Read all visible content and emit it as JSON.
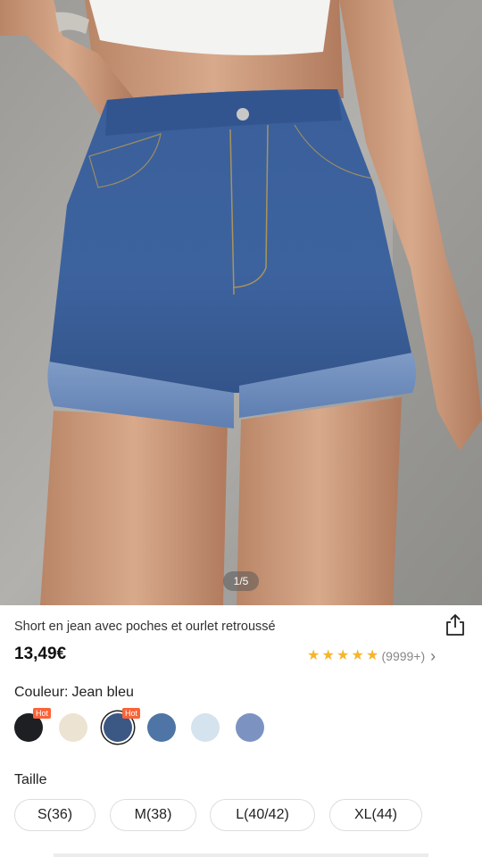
{
  "gallery": {
    "counter": "1/5"
  },
  "product": {
    "title": "Short en jean avec poches et ourlet retroussé",
    "price": "13,49€",
    "rating": {
      "stars": 5,
      "review_count": "(9999+)"
    }
  },
  "color": {
    "label": "Couleur:",
    "selected": "Jean bleu",
    "swatches": [
      {
        "color": "#1d1f22",
        "hot": "Hot",
        "selected": false
      },
      {
        "color": "#ece3d2",
        "hot": null,
        "selected": false
      },
      {
        "color": "#3b5783",
        "hot": "Hot",
        "selected": true
      },
      {
        "color": "#4f74a6",
        "hot": null,
        "selected": false
      },
      {
        "color": "#d4e3ee",
        "hot": null,
        "selected": false
      },
      {
        "color": "#7c93c2",
        "hot": null,
        "selected": false
      }
    ]
  },
  "size": {
    "label": "Taille",
    "options": [
      "S(36)",
      "M(38)",
      "L(40/42)",
      "XL(44)"
    ]
  },
  "icons": {
    "share": "share-icon",
    "star": "star-icon",
    "chevron": "chevron-right-icon"
  },
  "colors": {
    "hot_badge": "#fa6338",
    "star": "#f6b52a"
  }
}
